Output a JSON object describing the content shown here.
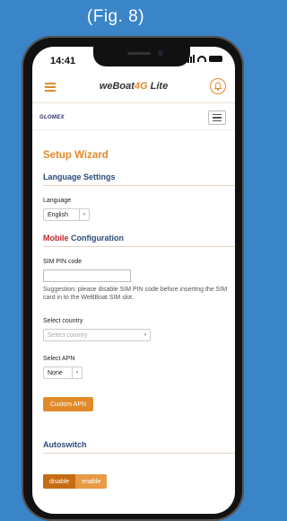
{
  "caption": "(Fig. 8)",
  "status_bar": {
    "time": "14:41"
  },
  "header": {
    "brand_main": "weBoat",
    "brand_accent": "4G",
    "brand_suffix": "Lite"
  },
  "logo_text": "GLOMEX",
  "wizard": {
    "title": "Setup Wizard"
  },
  "language": {
    "section_title": "Language Settings",
    "label": "Language",
    "selected": "English"
  },
  "mobile": {
    "section_title_accent": "Mobile",
    "section_title_rest": " Configuration",
    "pin_label": "SIM PIN code",
    "pin_value": "",
    "suggestion": "Suggestion: please disable SIM PIN code before inserting the SIM card in to the WeBBoat SIM slot.",
    "country_label": "Select country",
    "country_placeholder": "Select country",
    "apn_label": "Select APN",
    "apn_selected": "None",
    "custom_apn_button": "Custom APN"
  },
  "autoswitch": {
    "section_title": "Autoswitch",
    "disable_label": "disable",
    "enable_label": "enable",
    "active": "disable"
  },
  "colors": {
    "accent": "#e08a2a",
    "background": "#3a85c7",
    "section_heading": "#2b4a7a",
    "mobile_red": "#c0262a"
  }
}
